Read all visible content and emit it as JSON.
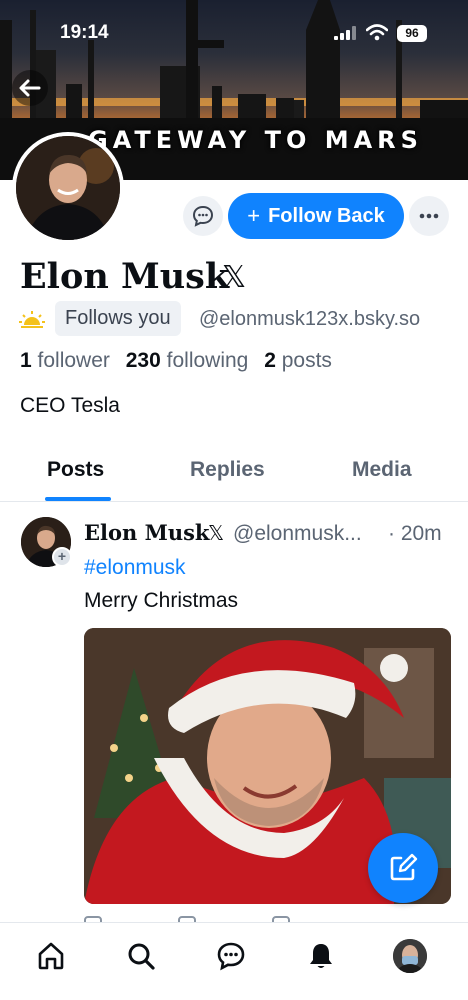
{
  "status_bar": {
    "time": "19:14",
    "battery": "96"
  },
  "banner": {
    "text": "GATEWAY TO MARS"
  },
  "profile": {
    "name": "Elon Musk",
    "name_suffix": "𝕏",
    "follows_you": "Follows you",
    "handle": "@elonmusk123x.bsky.so",
    "followers_count": "1",
    "followers_label": "follower",
    "following_count": "230",
    "following_label": "following",
    "posts_count": "2",
    "posts_label": "posts",
    "bio": "CEO Tesla"
  },
  "actions": {
    "follow_back": "Follow Back",
    "follow_plus": "+"
  },
  "tabs": [
    {
      "label": "Posts",
      "active": true
    },
    {
      "label": "Replies",
      "active": false
    },
    {
      "label": "Media",
      "active": false
    }
  ],
  "post": {
    "author": "Elon Musk",
    "author_suffix": "𝕏",
    "handle": "@elonmusk...",
    "time": "· 20m",
    "hashtag": "#elonmusk",
    "text": "Merry Christmas",
    "avatar_plus": "+"
  },
  "colors": {
    "accent": "#1083fe",
    "muted": "#5b6573",
    "chip_bg": "#eef1f5"
  },
  "icons": {
    "back": "arrow-left-icon",
    "message": "chat-bubble-icon",
    "more": "ellipsis-icon",
    "sun": "sun-icon",
    "compose": "pencil-square-icon",
    "nav": [
      "home-icon",
      "search-icon",
      "chat-icon",
      "bell-icon",
      "profile-avatar"
    ]
  }
}
